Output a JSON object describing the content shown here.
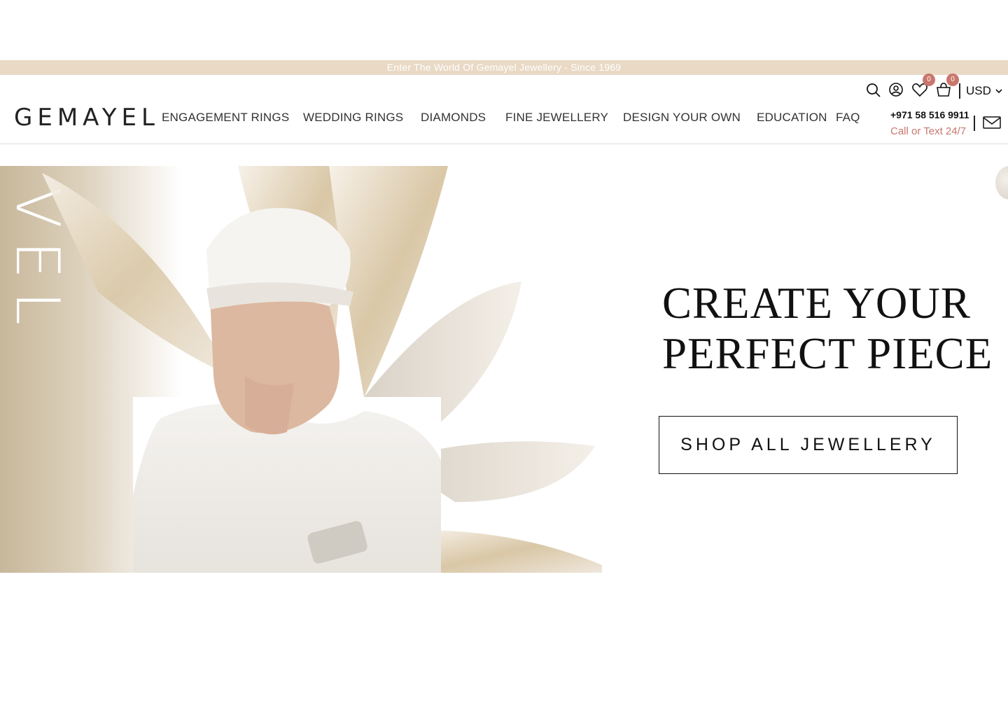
{
  "announcement": "Enter The World Of Gemayel Jewellery - Since 1969",
  "header": {
    "logo": "GEMAYEL",
    "nav": [
      {
        "label": "ENGAGEMENT RINGS"
      },
      {
        "label": "WEDDING RINGS"
      },
      {
        "label": "DIAMONDS"
      },
      {
        "label": "FINE JEWELLERY"
      },
      {
        "label": "DESIGN YOUR OWN"
      },
      {
        "label": "EDUCATION"
      },
      {
        "label": "FAQ"
      }
    ],
    "wishlist_count": "0",
    "cart_count": "0",
    "currency": "USD",
    "phone": "+971 58 516 9911",
    "call_text": "Call or Text 24/7",
    "icons": [
      "search-icon",
      "account-icon",
      "heart-icon",
      "bag-icon",
      "chevron-down-icon",
      "mail-icon"
    ]
  },
  "hero": {
    "title_line1": "CREATE YOUR",
    "title_line2": "PERFECT PIECE",
    "button": "SHOP ALL JEWELLERY",
    "side_letters": "VEL"
  },
  "colors": {
    "accent": "#c9776e",
    "announcement_bg": "#e9d9c5"
  }
}
